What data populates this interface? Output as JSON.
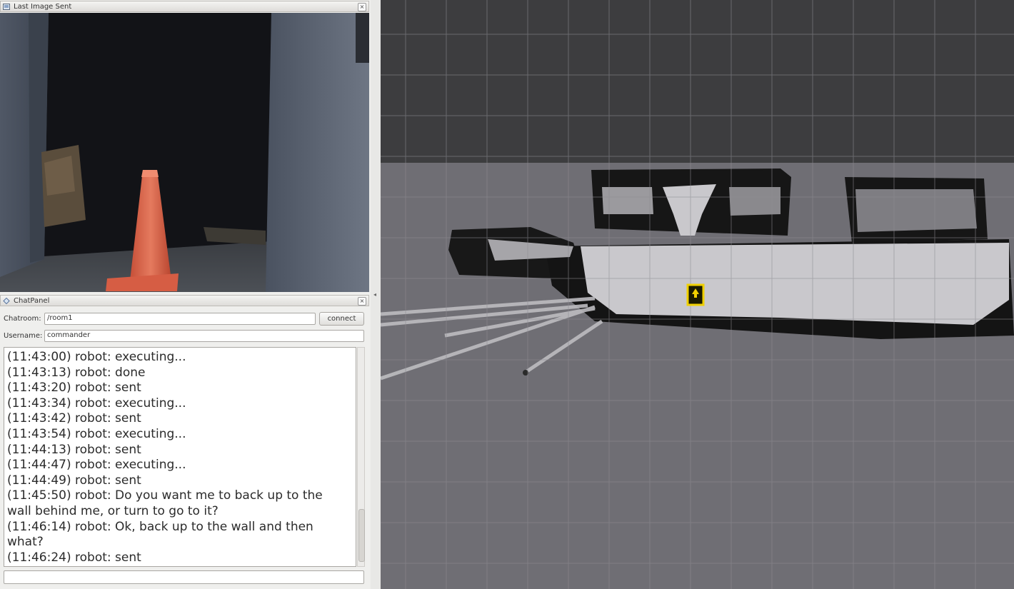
{
  "image_panel": {
    "title": "Last Image Sent",
    "close_glyph": "×"
  },
  "chat_panel": {
    "title": "ChatPanel",
    "close_glyph": "×",
    "chatroom_label": "Chatroom:",
    "chatroom_value": "/room1",
    "connect_label": "connect",
    "username_label": "Username:",
    "username_value": "commander",
    "messages": [
      "(11:43:00) robot: executing...",
      "(11:43:13) robot: done",
      "(11:43:20) robot: sent",
      "(11:43:34) robot: executing...",
      "(11:43:42) robot: sent",
      "(11:43:54) robot: executing...",
      "(11:44:13) robot: sent",
      "(11:44:47) robot: executing...",
      "(11:44:49) robot: sent",
      "(11:45:50) robot: Do you want me to back up to the wall behind me, or turn to go to it?",
      "(11:46:14) robot: Ok, back up to the wall and then what?",
      "(11:46:24) robot: sent"
    ],
    "message_input_value": ""
  },
  "icons": {
    "image_panel_icon": "image-window-icon",
    "chat_panel_icon": "diamond-icon",
    "robot_marker": "robot-position-icon"
  },
  "colors": {
    "robot_marker": "#f0d000",
    "cone": "#e0644a",
    "map_unknown": "#6f6e74",
    "map_free": "#c9c8cc",
    "map_occupied": "#141414"
  }
}
